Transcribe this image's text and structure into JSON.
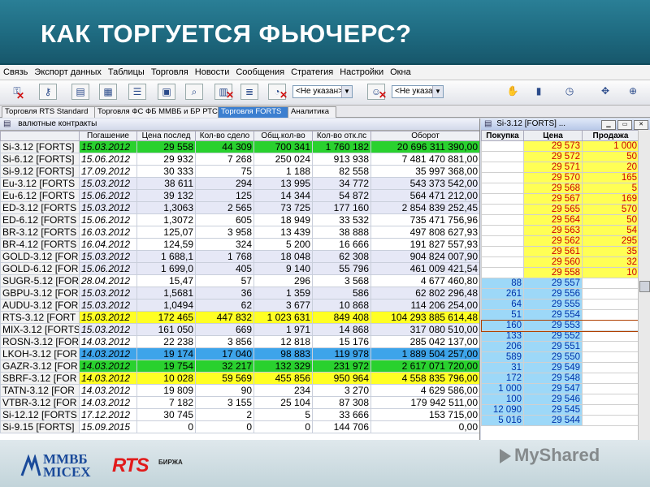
{
  "slide": {
    "title": "КАК ТОРГУЕТСЯ ФЬЮЧЕРС?",
    "logo_micex_line1": "ММВБ",
    "logo_micex_line2": "MICEX",
    "logo_rts": "RTS",
    "logo_rts_sub": "БИРЖА",
    "watermark": "MyShared"
  },
  "menu": [
    "Связь",
    "Экспорт данных",
    "Таблицы",
    "Торговля",
    "Новости",
    "Сообщения",
    "Стратегия",
    "Настройки",
    "Окна"
  ],
  "toolbar": {
    "combo1": "<Не указан>",
    "combo2": "<Не указан>"
  },
  "tabs": [
    "Торговля RTS Standard",
    "Торговля ФС ФБ ММВБ и БР РТС",
    "Торговля FORTS",
    "Аналитика"
  ],
  "main_window": {
    "title": "валютные контракты",
    "columns": [
      "",
      "Погашение",
      "Цена послед",
      "Кол-во сдело",
      "Общ.кол-во",
      "Кол-во отк.пс",
      "Оборот"
    ],
    "rows": [
      {
        "name": "Si-3.12 [FORTS]",
        "date": "15.03.2012",
        "price": "29 558",
        "deals": "44 309",
        "total": "700 341",
        "open": "1 760 182",
        "turnover": "20 696 311 390,00",
        "hl": "green"
      },
      {
        "name": "Si-6.12 [FORTS]",
        "date": "15.06.2012",
        "price": "29 932",
        "deals": "7 268",
        "total": "250 024",
        "open": "913 938",
        "turnover": "7 481 470 881,00",
        "hl": "r0"
      },
      {
        "name": "Si-9.12 [FORTS]",
        "date": "17.09.2012",
        "price": "30 333",
        "deals": "75",
        "total": "1 188",
        "open": "82 558",
        "turnover": "35 997 368,00",
        "hl": "r0"
      },
      {
        "name": "Eu-3.12 [FORTS",
        "date": "15.03.2012",
        "price": "38 611",
        "deals": "294",
        "total": "13 995",
        "open": "34 772",
        "turnover": "543 373 542,00",
        "hl": "r1"
      },
      {
        "name": "Eu-6.12 [FORTS",
        "date": "15.06.2012",
        "price": "39 132",
        "deals": "125",
        "total": "14 344",
        "open": "54 872",
        "turnover": "564 471 212,00",
        "hl": "r1"
      },
      {
        "name": "ED-3.12 [FORTS",
        "date": "15.03.2012",
        "price": "1,3063",
        "deals": "2 565",
        "total": "73 725",
        "open": "177 160",
        "turnover": "2 854 839 252,45",
        "hl": "r1"
      },
      {
        "name": "ED-6.12 [FORTS",
        "date": "15.06.2012",
        "price": "1,3072",
        "deals": "605",
        "total": "18 949",
        "open": "33 532",
        "turnover": "735 471 756,96",
        "hl": "r0"
      },
      {
        "name": "BR-3.12 [FORTS",
        "date": "16.03.2012",
        "price": "125,07",
        "deals": "3 958",
        "total": "13 439",
        "open": "38 888",
        "turnover": "497 808 627,93",
        "hl": "r0"
      },
      {
        "name": "BR-4.12 [FORTS",
        "date": "16.04.2012",
        "price": "124,59",
        "deals": "324",
        "total": "5 200",
        "open": "16 666",
        "turnover": "191 827 557,93",
        "hl": "r0"
      },
      {
        "name": "GOLD-3.12 [FOR",
        "date": "15.03.2012",
        "price": "1 688,1",
        "deals": "1 768",
        "total": "18 048",
        "open": "62 308",
        "turnover": "904 824 007,90",
        "hl": "r1"
      },
      {
        "name": "GOLD-6.12 [FOR",
        "date": "15.06.2012",
        "price": "1 699,0",
        "deals": "405",
        "total": "9 140",
        "open": "55 796",
        "turnover": "461 009 421,54",
        "hl": "r1"
      },
      {
        "name": "SUGR-5.12 [FOR",
        "date": "28.04.2012",
        "price": "15,47",
        "deals": "57",
        "total": "296",
        "open": "3 568",
        "turnover": "4 677 460,80",
        "hl": "r0"
      },
      {
        "name": "GBPU-3.12 [FOR",
        "date": "15.03.2012",
        "price": "1,5681",
        "deals": "36",
        "total": "1 359",
        "open": "586",
        "turnover": "62 802 296,48",
        "hl": "r1"
      },
      {
        "name": "AUDU-3.12 [FOR",
        "date": "15.03.2012",
        "price": "1,0494",
        "deals": "62",
        "total": "3 677",
        "open": "10 868",
        "turnover": "114 206 254,00",
        "hl": "r1"
      },
      {
        "name": "RTS-3.12 [FORT",
        "date": "15.03.2012",
        "price": "172 465",
        "deals": "447 832",
        "total": "1 023 631",
        "open": "849 408",
        "turnover": "104 293 885 614,48",
        "hl": "yellow"
      },
      {
        "name": "MIX-3.12 [FORTS",
        "date": "15.03.2012",
        "price": "161 050",
        "deals": "669",
        "total": "1 971",
        "open": "14 868",
        "turnover": "317 080 510,00",
        "hl": "r1"
      },
      {
        "name": "ROSN-3.12 [FOR",
        "date": "14.03.2012",
        "price": "22 238",
        "deals": "3 856",
        "total": "12 818",
        "open": "15 176",
        "turnover": "285 042 137,00",
        "hl": "r0"
      },
      {
        "name": "LKOH-3.12 [FOR",
        "date": "14.03.2012",
        "price": "19 174",
        "deals": "17 040",
        "total": "98 883",
        "open": "119 978",
        "turnover": "1 889 504 257,00",
        "hl": "blue"
      },
      {
        "name": "GAZR-3.12 [FOR",
        "date": "14.03.2012",
        "price": "19 754",
        "deals": "32 217",
        "total": "132 329",
        "open": "231 972",
        "turnover": "2 617 071 720,00",
        "hl": "green"
      },
      {
        "name": "SBRF-3.12 [FOR",
        "date": "14.03.2012",
        "price": "10 028",
        "deals": "59 569",
        "total": "455 856",
        "open": "950 964",
        "turnover": "4 558 835 796,00",
        "hl": "yellow"
      },
      {
        "name": "TATN-3.12 [FOR",
        "date": "14.03.2012",
        "price": "19 809",
        "deals": "90",
        "total": "234",
        "open": "3 270",
        "turnover": "4 629 586,00",
        "hl": "r0"
      },
      {
        "name": "VTBR-3.12 [FOR",
        "date": "14.03.2012",
        "price": "7 182",
        "deals": "3 155",
        "total": "25 104",
        "open": "87 308",
        "turnover": "179 942 511,00",
        "hl": "r0"
      },
      {
        "name": "Si-12.12 [FORTS",
        "date": "17.12.2012",
        "price": "30 745",
        "deals": "2",
        "total": "5",
        "open": "33 666",
        "turnover": "153 715,00",
        "hl": "r0"
      },
      {
        "name": "Si-9.15 [FORTS]",
        "date": "15.09.2015",
        "price": "0",
        "deals": "0",
        "total": "0",
        "open": "144 706",
        "turnover": "0,00",
        "hl": "r0"
      }
    ]
  },
  "depth_window": {
    "title": "Si-3.12 [FORTS] ...",
    "columns": [
      "Покупка",
      "Цена",
      "Продажа"
    ],
    "asks": [
      {
        "price": "29 573",
        "qty": "1 000"
      },
      {
        "price": "29 572",
        "qty": "50"
      },
      {
        "price": "29 571",
        "qty": "20"
      },
      {
        "price": "29 570",
        "qty": "165"
      },
      {
        "price": "29 568",
        "qty": "5"
      },
      {
        "price": "29 567",
        "qty": "169"
      },
      {
        "price": "29 565",
        "qty": "570"
      },
      {
        "price": "29 564",
        "qty": "50"
      },
      {
        "price": "29 563",
        "qty": "54"
      },
      {
        "price": "29 562",
        "qty": "295"
      },
      {
        "price": "29 561",
        "qty": "35"
      },
      {
        "price": "29 560",
        "qty": "32"
      },
      {
        "price": "29 558",
        "qty": "10"
      }
    ],
    "bids": [
      {
        "qty": "88",
        "price": "29 557"
      },
      {
        "qty": "261",
        "price": "29 556"
      },
      {
        "qty": "64",
        "price": "29 555"
      },
      {
        "qty": "51",
        "price": "29 554"
      },
      {
        "qty": "160",
        "price": "29 553"
      },
      {
        "qty": "133",
        "price": "29 552"
      },
      {
        "qty": "206",
        "price": "29 551"
      },
      {
        "qty": "589",
        "price": "29 550"
      },
      {
        "qty": "31",
        "price": "29 549"
      },
      {
        "qty": "172",
        "price": "29 548"
      },
      {
        "qty": "1 000",
        "price": "29 547"
      },
      {
        "qty": "100",
        "price": "29 546"
      },
      {
        "qty": "12 090",
        "price": "29 545"
      },
      {
        "qty": "5 016",
        "price": "29 544"
      }
    ]
  },
  "colors": {
    "banner": "#1e6a80",
    "green": "#29d12e",
    "yellow": "#ffff24",
    "blue": "#3da4ea",
    "ask_bg": "#ffff55",
    "bid_bg": "#9dd8f8"
  }
}
